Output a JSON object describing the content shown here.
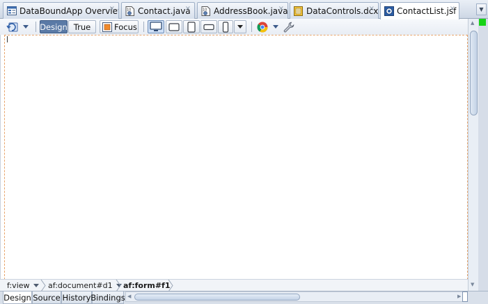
{
  "tabs": [
    {
      "label": "DataBoundApp Overview",
      "icon": "overview-icon",
      "active": false
    },
    {
      "label": "Contact.java",
      "icon": "java-file-icon",
      "active": false
    },
    {
      "label": "AddressBook.java",
      "icon": "java-file-icon",
      "active": false
    },
    {
      "label": "DataControls.dcx",
      "icon": "dcx-file-icon",
      "active": false
    },
    {
      "label": "ContactList.jsf",
      "icon": "jsf-file-icon",
      "active": true
    }
  ],
  "tab_close_glyph": "×",
  "toolbar": {
    "design_label": "Design",
    "true_label": "True",
    "focus_label": "Focus",
    "design_pressed": true,
    "device_icons": [
      "desktop-icon",
      "tablet-landscape-icon",
      "tablet-portrait-icon",
      "phone-landscape-icon",
      "phone-portrait-icon"
    ],
    "browser_icon": "chrome-browser-icon",
    "settings_icon": "wrench-icon"
  },
  "breadcrumb": {
    "items": [
      {
        "label": "f:view",
        "has_dropdown": true
      },
      {
        "label": "af:document#d1",
        "has_dropdown": true
      },
      {
        "label": "af:form#f1",
        "has_dropdown": false,
        "current": true
      }
    ]
  },
  "bottom_tabs": [
    {
      "label": "Design",
      "active": true
    },
    {
      "label": "Source",
      "active": false
    },
    {
      "label": "History",
      "active": false
    },
    {
      "label": "Bindings",
      "active": false
    }
  ],
  "colors": {
    "accent": "#5a7aa6",
    "form_outline": "#e8a46a",
    "status_indicator": "#16d316"
  }
}
